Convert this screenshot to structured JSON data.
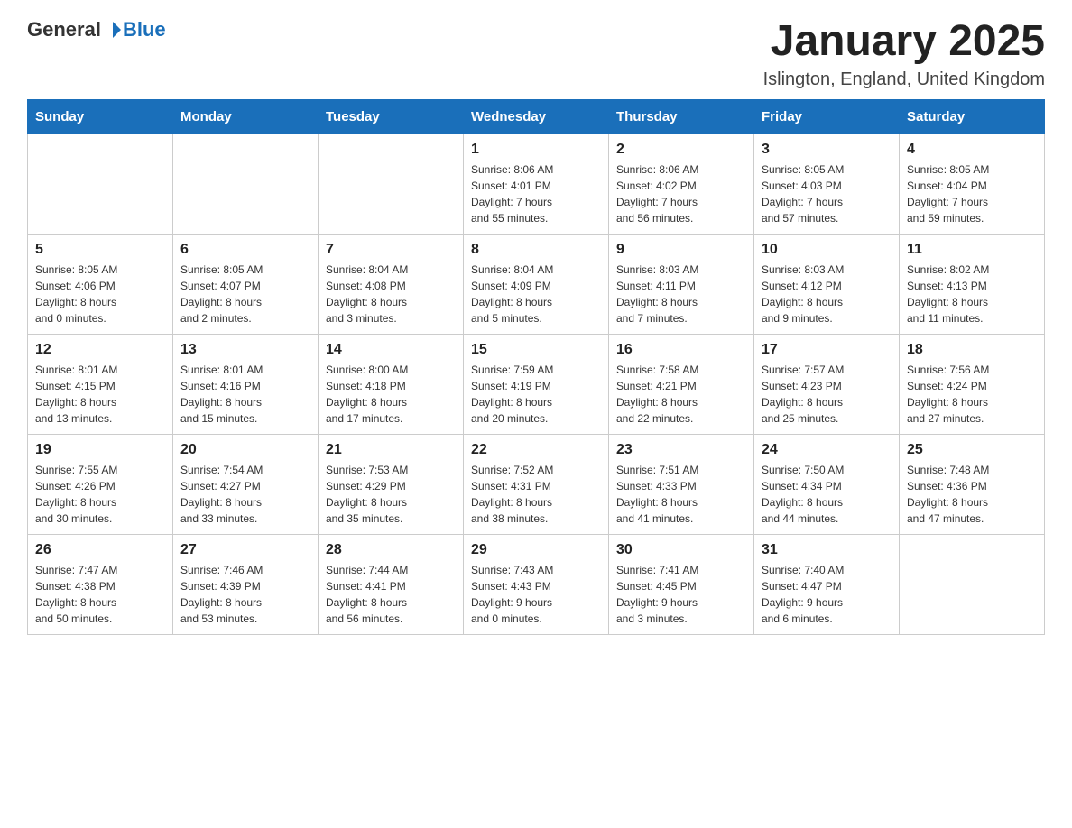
{
  "header": {
    "logo_general": "General",
    "logo_blue": "Blue",
    "month_title": "January 2025",
    "location": "Islington, England, United Kingdom"
  },
  "days_of_week": [
    "Sunday",
    "Monday",
    "Tuesday",
    "Wednesday",
    "Thursday",
    "Friday",
    "Saturday"
  ],
  "weeks": [
    [
      {
        "day": "",
        "info": ""
      },
      {
        "day": "",
        "info": ""
      },
      {
        "day": "",
        "info": ""
      },
      {
        "day": "1",
        "info": "Sunrise: 8:06 AM\nSunset: 4:01 PM\nDaylight: 7 hours\nand 55 minutes."
      },
      {
        "day": "2",
        "info": "Sunrise: 8:06 AM\nSunset: 4:02 PM\nDaylight: 7 hours\nand 56 minutes."
      },
      {
        "day": "3",
        "info": "Sunrise: 8:05 AM\nSunset: 4:03 PM\nDaylight: 7 hours\nand 57 minutes."
      },
      {
        "day": "4",
        "info": "Sunrise: 8:05 AM\nSunset: 4:04 PM\nDaylight: 7 hours\nand 59 minutes."
      }
    ],
    [
      {
        "day": "5",
        "info": "Sunrise: 8:05 AM\nSunset: 4:06 PM\nDaylight: 8 hours\nand 0 minutes."
      },
      {
        "day": "6",
        "info": "Sunrise: 8:05 AM\nSunset: 4:07 PM\nDaylight: 8 hours\nand 2 minutes."
      },
      {
        "day": "7",
        "info": "Sunrise: 8:04 AM\nSunset: 4:08 PM\nDaylight: 8 hours\nand 3 minutes."
      },
      {
        "day": "8",
        "info": "Sunrise: 8:04 AM\nSunset: 4:09 PM\nDaylight: 8 hours\nand 5 minutes."
      },
      {
        "day": "9",
        "info": "Sunrise: 8:03 AM\nSunset: 4:11 PM\nDaylight: 8 hours\nand 7 minutes."
      },
      {
        "day": "10",
        "info": "Sunrise: 8:03 AM\nSunset: 4:12 PM\nDaylight: 8 hours\nand 9 minutes."
      },
      {
        "day": "11",
        "info": "Sunrise: 8:02 AM\nSunset: 4:13 PM\nDaylight: 8 hours\nand 11 minutes."
      }
    ],
    [
      {
        "day": "12",
        "info": "Sunrise: 8:01 AM\nSunset: 4:15 PM\nDaylight: 8 hours\nand 13 minutes."
      },
      {
        "day": "13",
        "info": "Sunrise: 8:01 AM\nSunset: 4:16 PM\nDaylight: 8 hours\nand 15 minutes."
      },
      {
        "day": "14",
        "info": "Sunrise: 8:00 AM\nSunset: 4:18 PM\nDaylight: 8 hours\nand 17 minutes."
      },
      {
        "day": "15",
        "info": "Sunrise: 7:59 AM\nSunset: 4:19 PM\nDaylight: 8 hours\nand 20 minutes."
      },
      {
        "day": "16",
        "info": "Sunrise: 7:58 AM\nSunset: 4:21 PM\nDaylight: 8 hours\nand 22 minutes."
      },
      {
        "day": "17",
        "info": "Sunrise: 7:57 AM\nSunset: 4:23 PM\nDaylight: 8 hours\nand 25 minutes."
      },
      {
        "day": "18",
        "info": "Sunrise: 7:56 AM\nSunset: 4:24 PM\nDaylight: 8 hours\nand 27 minutes."
      }
    ],
    [
      {
        "day": "19",
        "info": "Sunrise: 7:55 AM\nSunset: 4:26 PM\nDaylight: 8 hours\nand 30 minutes."
      },
      {
        "day": "20",
        "info": "Sunrise: 7:54 AM\nSunset: 4:27 PM\nDaylight: 8 hours\nand 33 minutes."
      },
      {
        "day": "21",
        "info": "Sunrise: 7:53 AM\nSunset: 4:29 PM\nDaylight: 8 hours\nand 35 minutes."
      },
      {
        "day": "22",
        "info": "Sunrise: 7:52 AM\nSunset: 4:31 PM\nDaylight: 8 hours\nand 38 minutes."
      },
      {
        "day": "23",
        "info": "Sunrise: 7:51 AM\nSunset: 4:33 PM\nDaylight: 8 hours\nand 41 minutes."
      },
      {
        "day": "24",
        "info": "Sunrise: 7:50 AM\nSunset: 4:34 PM\nDaylight: 8 hours\nand 44 minutes."
      },
      {
        "day": "25",
        "info": "Sunrise: 7:48 AM\nSunset: 4:36 PM\nDaylight: 8 hours\nand 47 minutes."
      }
    ],
    [
      {
        "day": "26",
        "info": "Sunrise: 7:47 AM\nSunset: 4:38 PM\nDaylight: 8 hours\nand 50 minutes."
      },
      {
        "day": "27",
        "info": "Sunrise: 7:46 AM\nSunset: 4:39 PM\nDaylight: 8 hours\nand 53 minutes."
      },
      {
        "day": "28",
        "info": "Sunrise: 7:44 AM\nSunset: 4:41 PM\nDaylight: 8 hours\nand 56 minutes."
      },
      {
        "day": "29",
        "info": "Sunrise: 7:43 AM\nSunset: 4:43 PM\nDaylight: 9 hours\nand 0 minutes."
      },
      {
        "day": "30",
        "info": "Sunrise: 7:41 AM\nSunset: 4:45 PM\nDaylight: 9 hours\nand 3 minutes."
      },
      {
        "day": "31",
        "info": "Sunrise: 7:40 AM\nSunset: 4:47 PM\nDaylight: 9 hours\nand 6 minutes."
      },
      {
        "day": "",
        "info": ""
      }
    ]
  ]
}
